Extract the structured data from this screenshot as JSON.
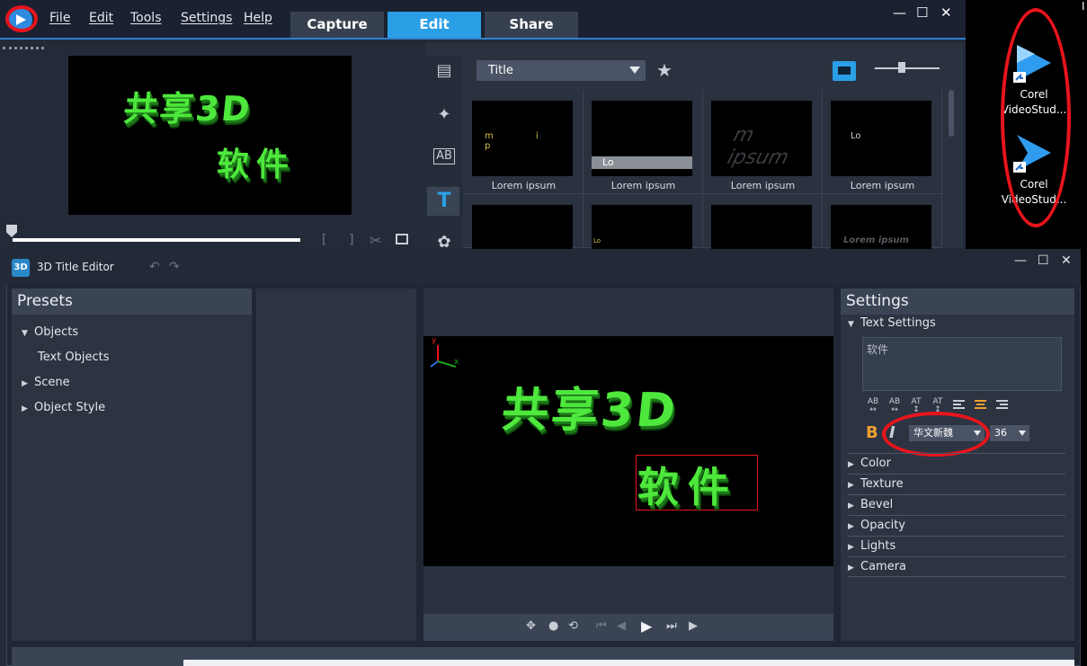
{
  "menu": [
    "File",
    "Edit",
    "Tools",
    "Settings",
    "Help"
  ],
  "mode_tabs": [
    "Capture",
    "Edit",
    "Share"
  ],
  "active_mode": "Edit",
  "window_controls": {
    "minimize": "—",
    "maximize": "☐",
    "close": "✕"
  },
  "preview_text": {
    "line1": "共享3D",
    "line2": "软件"
  },
  "library": {
    "category": "Title",
    "thumbnails": [
      {
        "caption": "Lorem ipsum",
        "sample": "m i p"
      },
      {
        "caption": "Lorem ipsum",
        "sample": "Lo"
      },
      {
        "caption": "Lorem ipsum",
        "sample": "m ipsum"
      },
      {
        "caption": "Lorem ipsum",
        "sample": "Lo"
      },
      {
        "caption": "",
        "sample": ""
      },
      {
        "caption": "",
        "sample": "Lo"
      },
      {
        "caption": "",
        "sample": ""
      },
      {
        "caption": "",
        "sample": "Lorem ipsum"
      }
    ]
  },
  "desktop": {
    "icons": [
      {
        "label": "Corel VideoStud...",
        "icon": "corel-videostudio-icon"
      },
      {
        "label": "Corel VideoStud...",
        "icon": "corel-videostudio-icon"
      }
    ]
  },
  "editor": {
    "logo": "3D",
    "title": "3D Title Editor",
    "presets": {
      "header": "Presets",
      "tree": [
        {
          "label": "Objects",
          "expanded": true
        },
        {
          "label": "Text Objects",
          "child": true
        },
        {
          "label": "Scene",
          "expanded": false
        },
        {
          "label": "Object Style",
          "expanded": false
        }
      ]
    },
    "viewport_text": {
      "line1": "共享3D",
      "line2": "软件"
    },
    "axes": {
      "y": "y",
      "x": "x"
    },
    "settings": {
      "header": "Settings",
      "text_settings": "Text Settings",
      "text_value": "软件",
      "format_buttons": [
        "AB",
        "AB",
        "AT",
        "AT"
      ],
      "bold": "B",
      "italic": "I",
      "font": "华文新魏",
      "size": "36",
      "sections": [
        "Color",
        "Texture",
        "Bevel",
        "Opacity",
        "Lights",
        "Camera"
      ]
    }
  },
  "colors": {
    "accent": "#2a9fe6",
    "annotation": "#e8141c",
    "text3d": "#4ee83c",
    "active_format": "#f0a030"
  }
}
